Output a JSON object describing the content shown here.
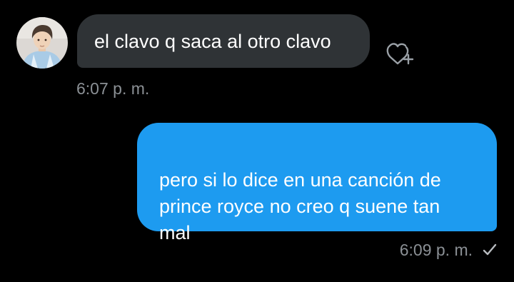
{
  "messages": [
    {
      "direction": "incoming",
      "text": "el clavo q saca al otro clavo",
      "time": "6:07 p. m.",
      "like_icon": "heart-plus-icon"
    },
    {
      "direction": "outgoing",
      "text": "pero si lo dice en una canción de\nprince royce no creo q suene tan\nmal",
      "time": "6:09 p. m.",
      "status_icon": "check-icon"
    }
  ],
  "colors": {
    "background": "#000000",
    "incoming_bubble": "#2f3336",
    "outgoing_bubble": "#1d9bf0",
    "timestamp": "#8b9095",
    "icon": "#9aa0a6"
  }
}
